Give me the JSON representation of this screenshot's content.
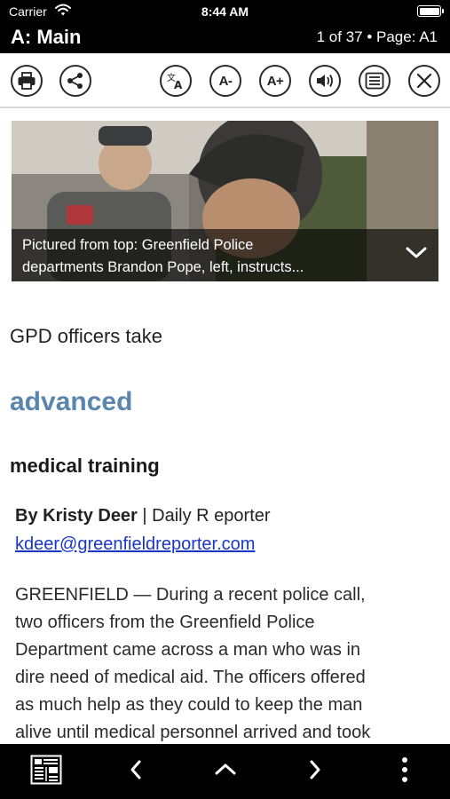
{
  "status_bar": {
    "carrier": "Carrier",
    "time": "8:44 AM",
    "wifi_icon": "wifi-icon",
    "battery_icon": "battery-icon"
  },
  "header": {
    "section_title": "A: Main",
    "page_indicator": "1 of 37 • Page: A1"
  },
  "toolbar": {
    "buttons": [
      {
        "name": "print",
        "icon": "printer-icon"
      },
      {
        "name": "share",
        "icon": "share-icon"
      },
      {
        "name": "translate",
        "icon": "translate-icon"
      },
      {
        "name": "decrease-font",
        "icon": "font-decrease-icon",
        "label": "A-"
      },
      {
        "name": "increase-font",
        "icon": "font-increase-icon",
        "label": "A+"
      },
      {
        "name": "read-aloud",
        "icon": "speaker-icon"
      },
      {
        "name": "text-view",
        "icon": "article-icon"
      },
      {
        "name": "close",
        "icon": "close-icon"
      }
    ]
  },
  "hero": {
    "caption_line1": "Pictured from top:  Greenfield Police",
    "caption_line2": "departments Brandon Pope, left, instructs...",
    "expand_icon": "chevron-down-icon"
  },
  "article": {
    "headline_part1": "GPD officers take",
    "headline_part2": "advanced",
    "headline_part3": "medical training",
    "author": "By Kristy Deer",
    "byline_rest": " | Daily R eporter",
    "email": "kdeer@greenfieldreporter.com",
    "body_lines": [
      "GREENFIELD — During a recent police call,",
      "two officers from the Greenfield Police",
      "Department came across a man who was in",
      "dire need of medical aid. The officers offered",
      "as much help as they could to keep the man",
      "alive until medical personnel arrived and took"
    ]
  },
  "colors": {
    "accent_headline": "#5a85ad",
    "link": "#1a37c9",
    "bar_background": "#000000"
  },
  "bottom_bar": {
    "buttons": [
      {
        "name": "page-thumbnails",
        "icon": "newspaper-grid-icon"
      },
      {
        "name": "previous",
        "icon": "chevron-left-icon"
      },
      {
        "name": "up",
        "icon": "chevron-up-icon"
      },
      {
        "name": "next",
        "icon": "chevron-right-icon"
      },
      {
        "name": "more",
        "icon": "more-vertical-icon"
      }
    ]
  }
}
